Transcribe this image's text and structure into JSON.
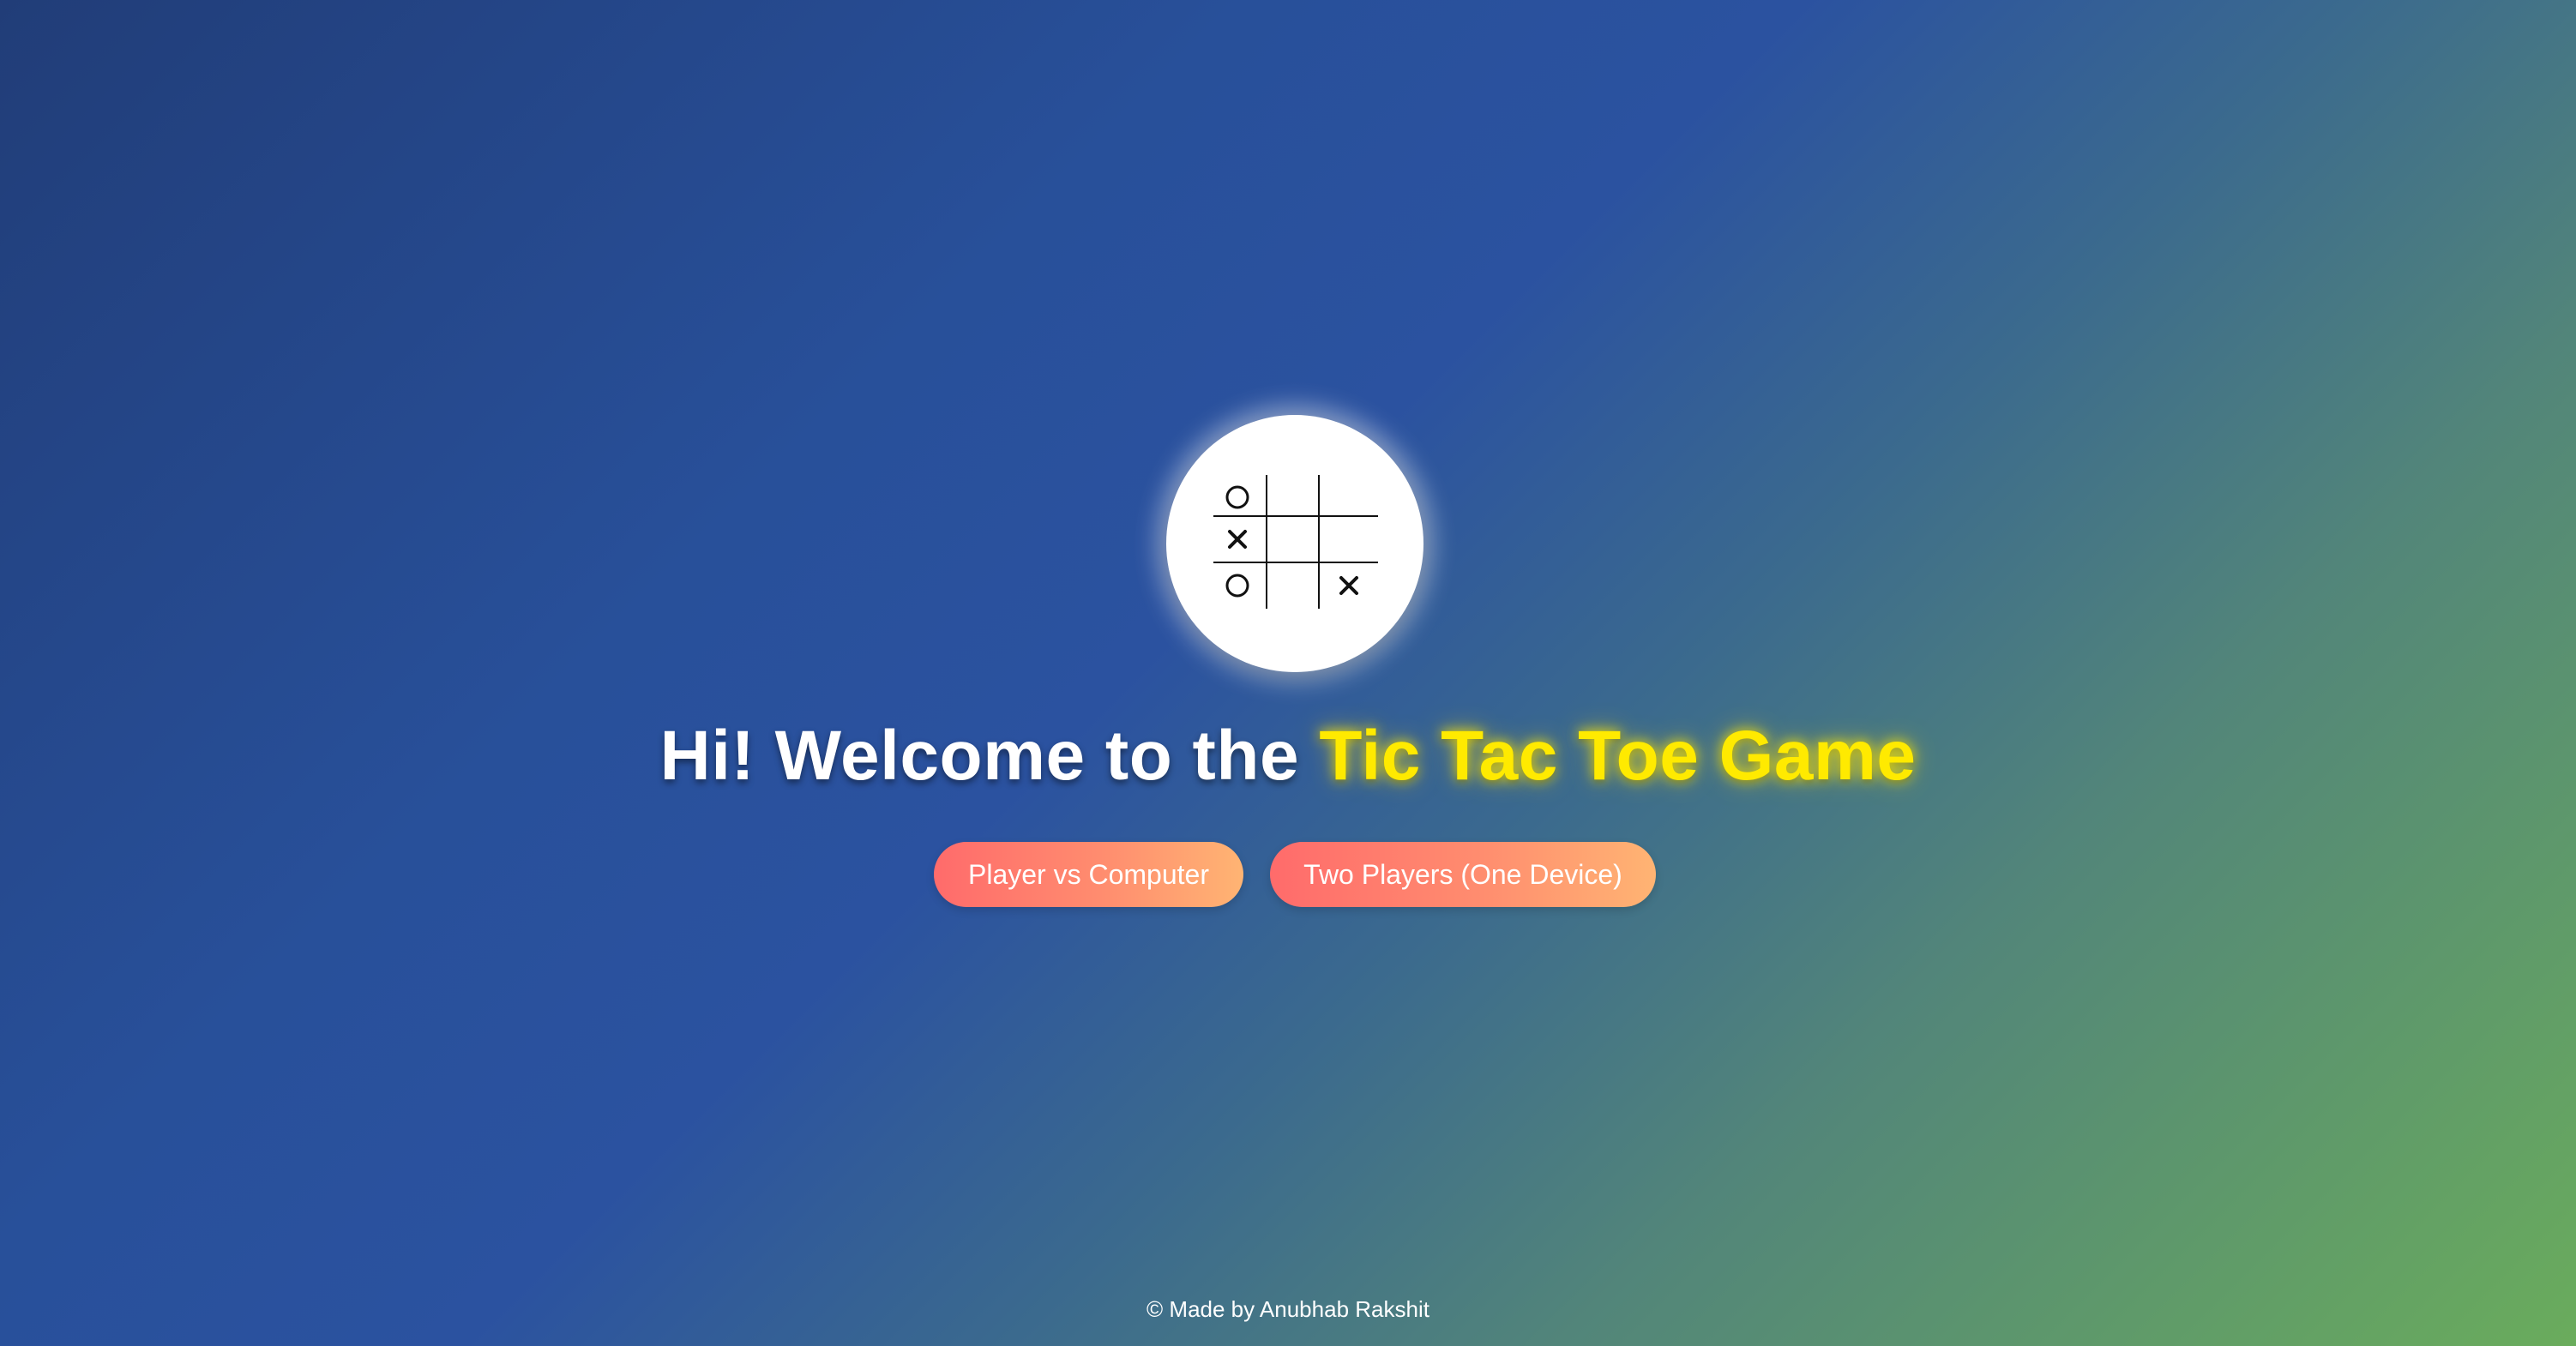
{
  "logo": {
    "icon": "tic-tac-toe-board-icon",
    "cells": [
      [
        "O",
        "",
        ""
      ],
      [
        "X",
        "",
        ""
      ],
      [
        "O",
        "",
        "X"
      ]
    ]
  },
  "headline": {
    "prefix": "Hi! Welcome to the ",
    "highlight": "Tic Tac Toe Game"
  },
  "buttons": {
    "player_vs_computer": "Player vs Computer",
    "two_players": "Two Players (One Device)"
  },
  "footer": {
    "credit": "© Made by Anubhab Rakshit"
  },
  "colors": {
    "highlight": "#ffea00",
    "button_gradient_start": "#ff6b6b",
    "button_gradient_end": "#ffb473",
    "background_start": "#213d78",
    "background_end": "#6aac5c"
  }
}
